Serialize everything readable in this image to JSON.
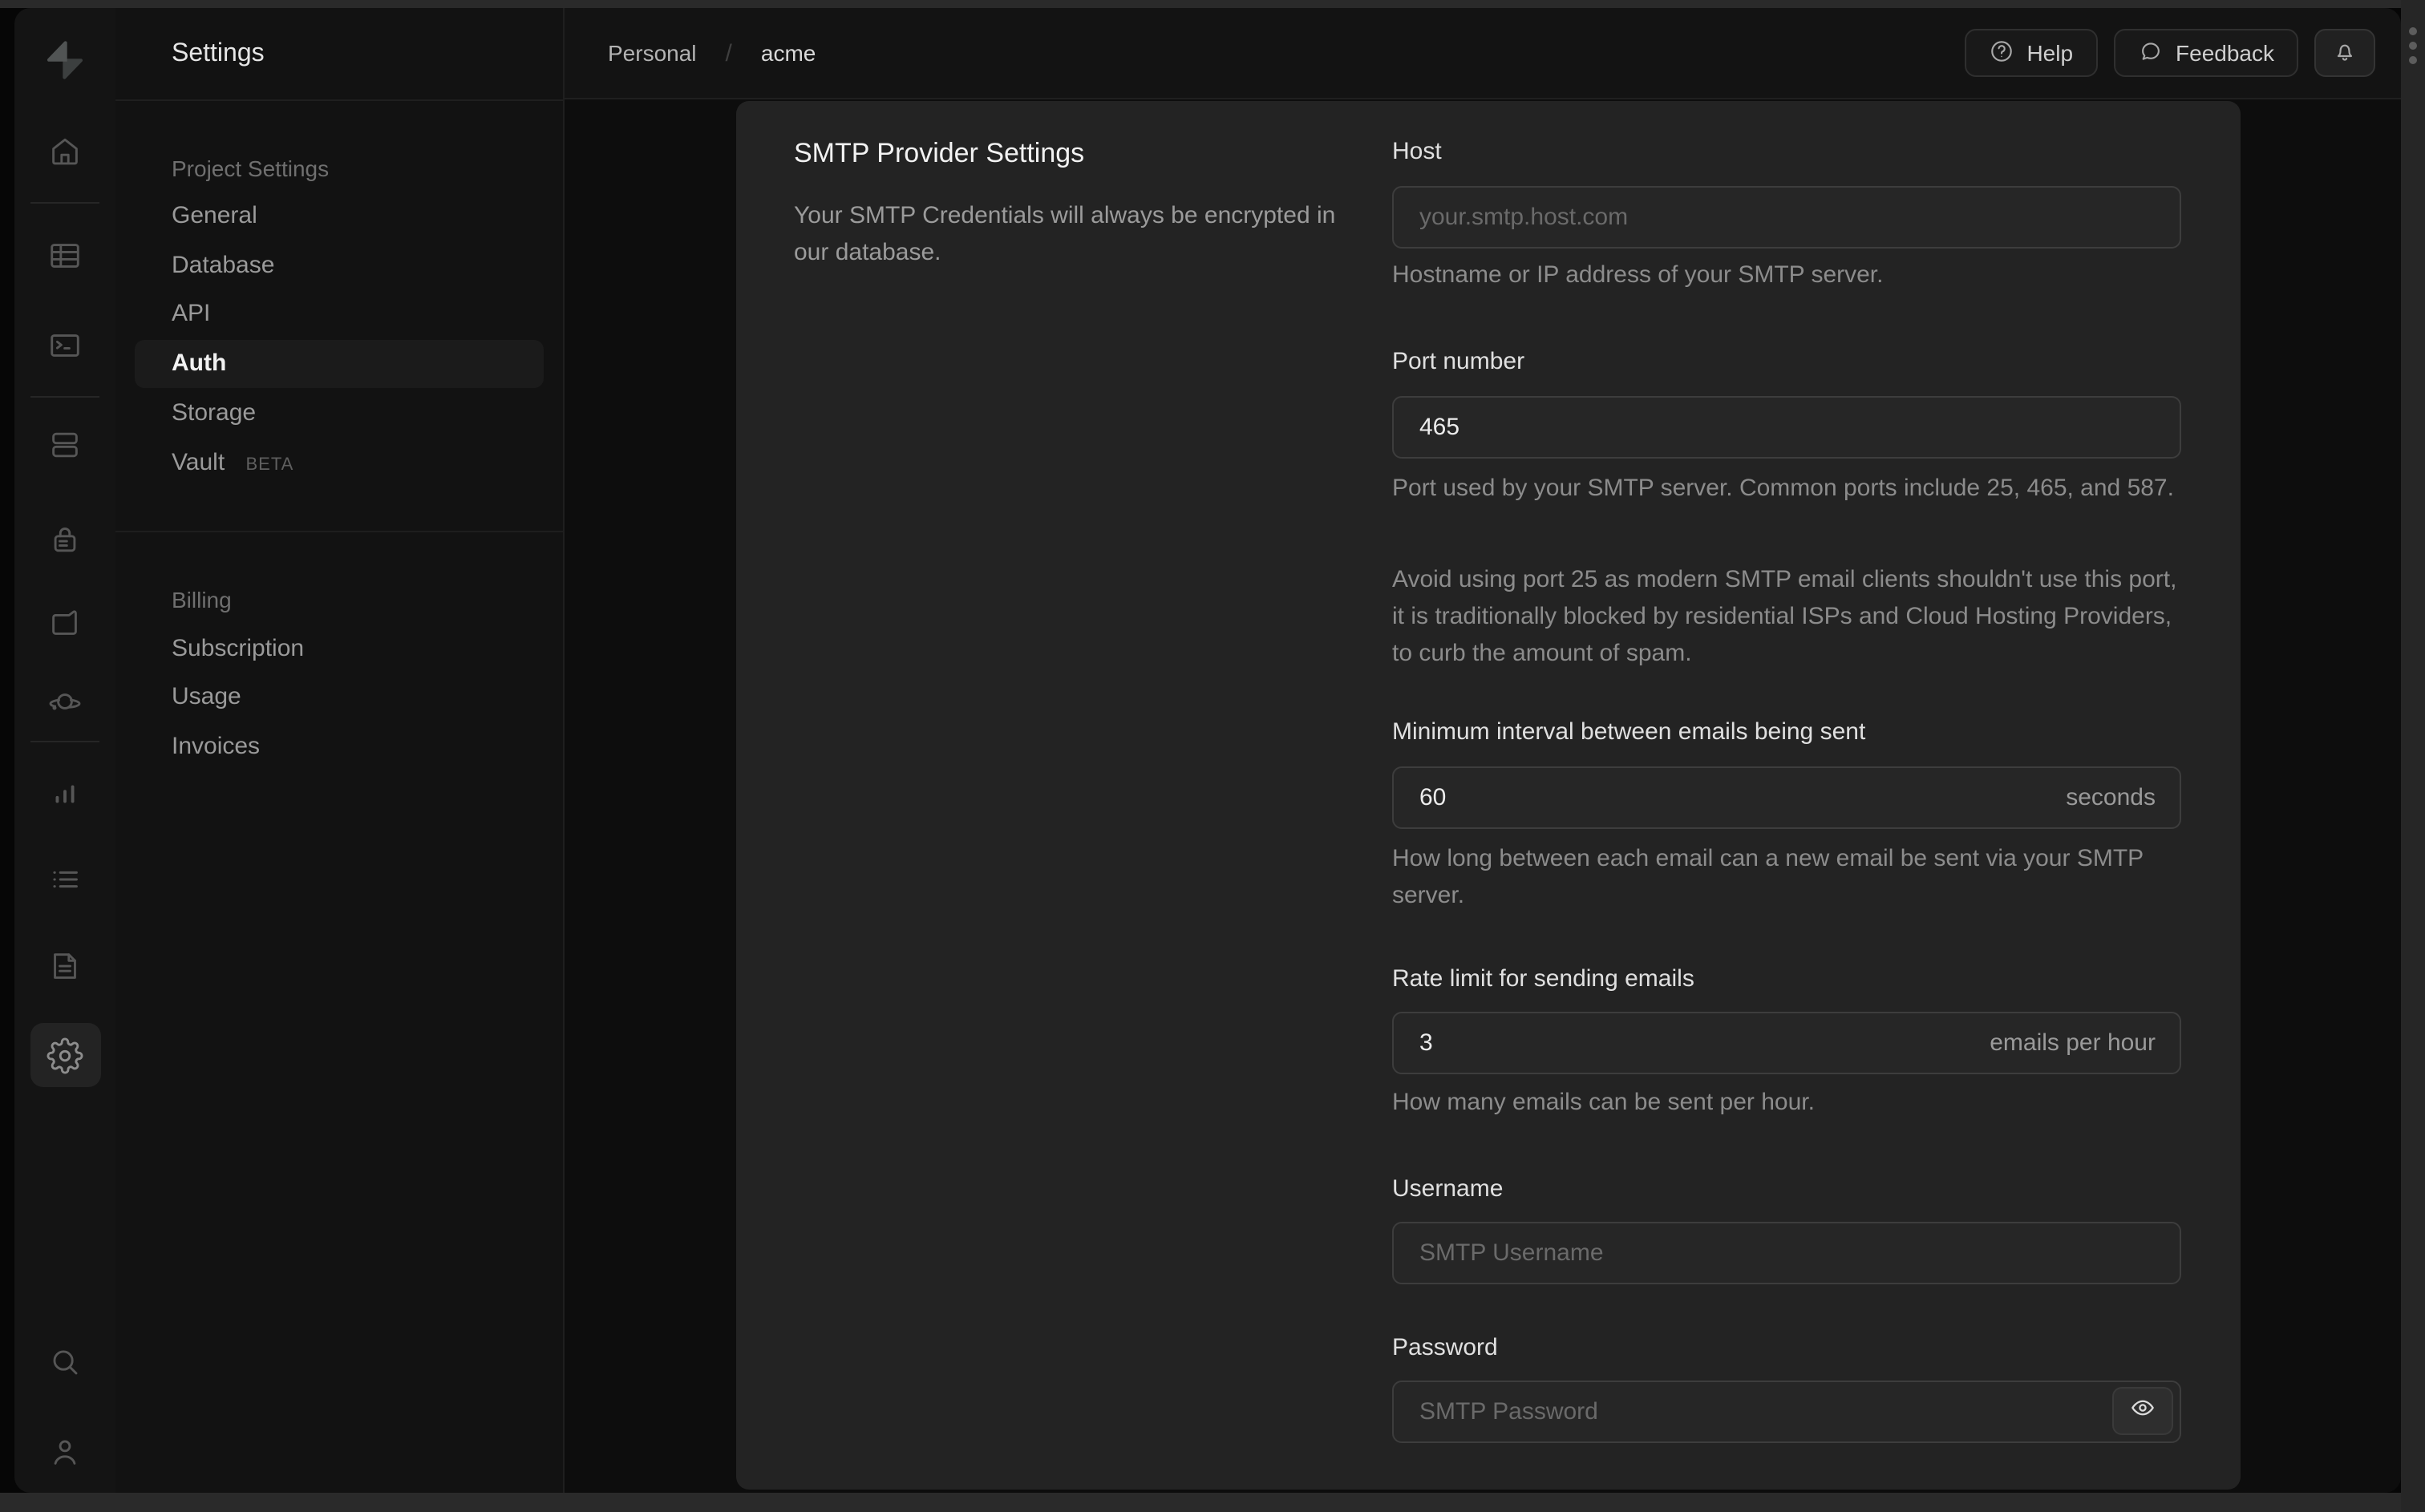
{
  "nav": {
    "title": "Settings",
    "sections": [
      {
        "header": "Project Settings",
        "items": [
          {
            "label": "General"
          },
          {
            "label": "Database"
          },
          {
            "label": "API"
          },
          {
            "label": "Auth",
            "selected": true
          },
          {
            "label": "Storage"
          },
          {
            "label": "Vault",
            "badge": "BETA"
          }
        ]
      },
      {
        "header": "Billing",
        "items": [
          {
            "label": "Subscription"
          },
          {
            "label": "Usage"
          },
          {
            "label": "Invoices"
          }
        ]
      }
    ]
  },
  "rail": {
    "icons": [
      "supabase-logo",
      "home",
      "table-editor",
      "sql-editor",
      "database",
      "auth",
      "storage",
      "edge-functions",
      "reports",
      "logs",
      "api-docs",
      "settings",
      "search",
      "user"
    ],
    "active": "settings"
  },
  "topbar": {
    "breadcrumb": {
      "org": "Personal",
      "separator": "/",
      "project": "acme"
    },
    "help_label": "Help",
    "feedback_label": "Feedback",
    "icons": [
      "help-circle",
      "chat-bubble",
      "bell"
    ]
  },
  "form": {
    "heading": "SMTP Provider Settings",
    "description": "Your SMTP Credentials will always be encrypted in our database.",
    "fields": {
      "host": {
        "label": "Host",
        "placeholder": "your.smtp.host.com",
        "helper": "Hostname or IP address of your SMTP server."
      },
      "port": {
        "label": "Port number",
        "value": "465",
        "helper": "Port used by your SMTP server. Common ports include 25, 465, and 587.",
        "helper2": "Avoid using port 25 as modern SMTP email clients shouldn't use this port, it is traditionally blocked by residential ISPs and Cloud Hosting Providers, to curb the amount of spam."
      },
      "interval": {
        "label": "Minimum interval between emails being sent",
        "value": "60",
        "suffix": "seconds",
        "helper": "How long between each email can a new email be sent via your SMTP server."
      },
      "rate": {
        "label": "Rate limit for sending emails",
        "value": "3",
        "suffix": "emails per hour",
        "helper": "How many emails can be sent per hour."
      },
      "username": {
        "label": "Username",
        "placeholder": "SMTP Username"
      },
      "password": {
        "label": "Password",
        "placeholder": "SMTP Password"
      }
    }
  },
  "colors": {
    "card_bg": "#232323",
    "page_bg": "#0d0d0d",
    "sidebar_bg": "#121212",
    "selected_bg": "#1b1b1b",
    "input_bg": "#262626",
    "input_border": "#3d3d3d"
  }
}
